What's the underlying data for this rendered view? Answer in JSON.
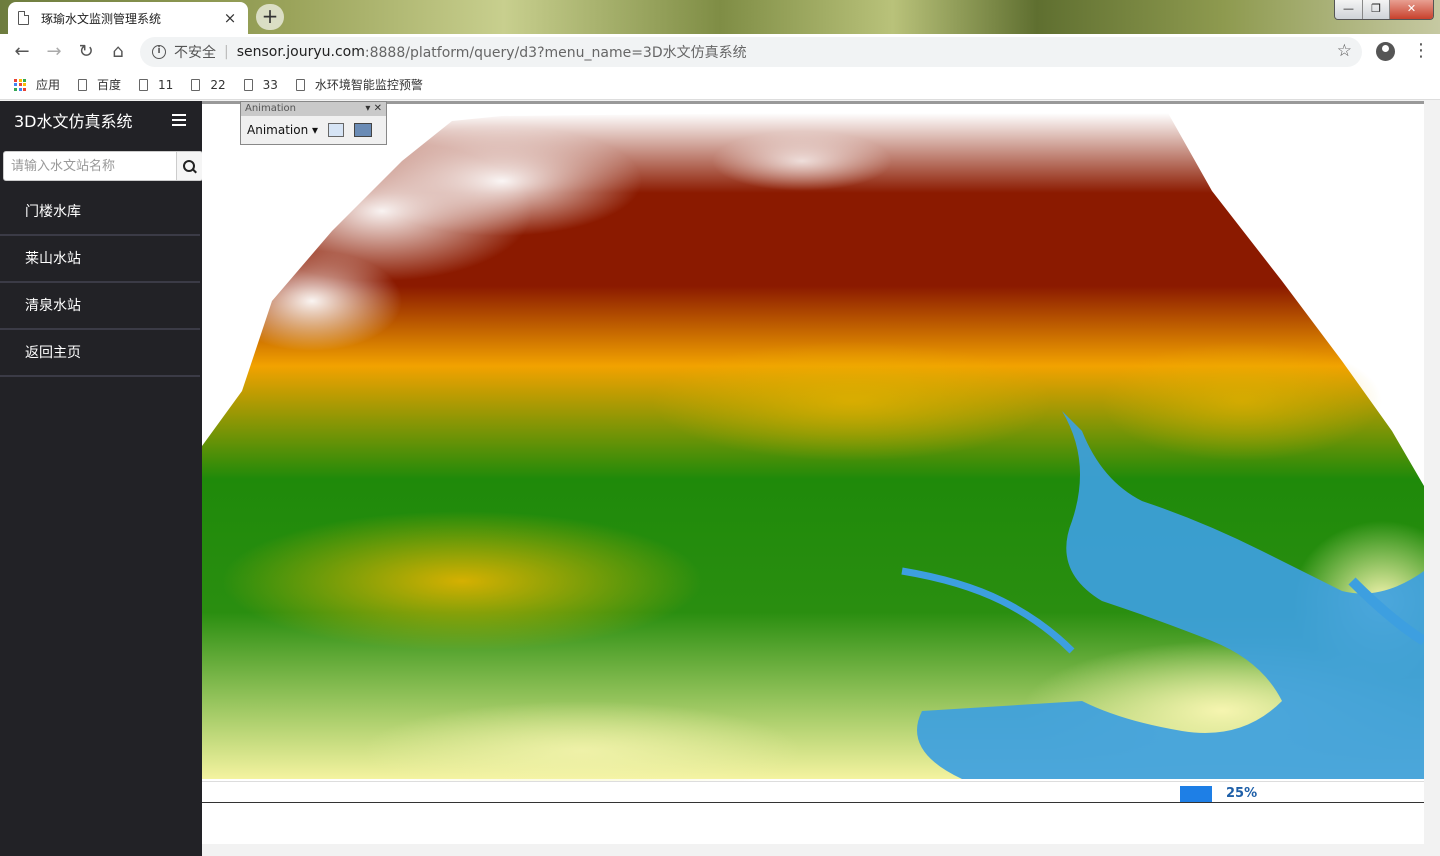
{
  "browser": {
    "tab_title": "琢瑜水文监测管理系统",
    "tab_close": "×",
    "new_tab": "+",
    "address": {
      "security_label": "不安全",
      "host": "sensor.jouryu.com",
      "path": ":8888/platform/query/d3?menu_name=3D水文仿真系统"
    },
    "bookmarks": [
      {
        "label": "应用",
        "icon": "apps-grid-icon"
      },
      {
        "label": "百度",
        "icon": "page-icon"
      },
      {
        "label": "11",
        "icon": "page-icon"
      },
      {
        "label": "22",
        "icon": "page-icon"
      },
      {
        "label": "33",
        "icon": "page-icon"
      },
      {
        "label": "水环境智能监控预警",
        "icon": "page-icon"
      }
    ]
  },
  "sidebar": {
    "title": "3D水文仿真系统",
    "search_placeholder": "请输入水文站名称",
    "items": [
      {
        "label": "门楼水库"
      },
      {
        "label": "莱山水站"
      },
      {
        "label": "清泉水站"
      },
      {
        "label": "返回主页"
      }
    ]
  },
  "viewer": {
    "toolbar_title": "Animation",
    "dropdown_label": "Animation ▾",
    "progress_percent": 25,
    "progress_text": "25%"
  },
  "colors": {
    "sidebar_bg": "#222226",
    "menu_divider": "#3b3b46",
    "progress_blue": "#1e7fe6",
    "terrain_peak": "#ffffff",
    "terrain_high": "#8b1a00",
    "terrain_mid": "#f2a200",
    "terrain_low": "#1f8a0a",
    "terrain_plain": "#f4f3a0",
    "water": "#3d9fe0"
  }
}
